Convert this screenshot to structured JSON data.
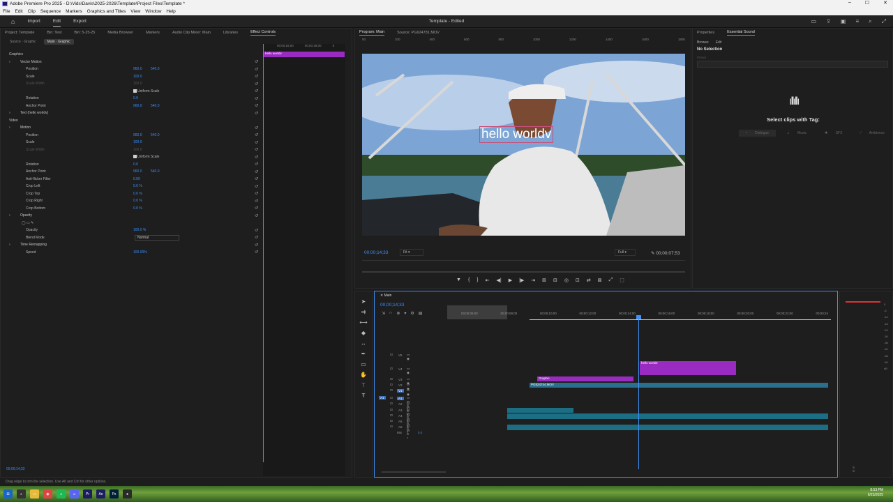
{
  "titlebar": {
    "title": "Adobe Premiere Pro 2025 - D:\\Vids\\Davis\\2025-2026\\Template\\Project Files\\Template *",
    "min": "–",
    "max": "☐",
    "close": "✕"
  },
  "menu": [
    "File",
    "Edit",
    "Clip",
    "Sequence",
    "Markers",
    "Graphics and Titles",
    "View",
    "Window",
    "Help"
  ],
  "appbar": {
    "workspaces": [
      "Import",
      "Edit",
      "Export"
    ],
    "project": "Template - Edited"
  },
  "left_tabs": [
    "Project: Template",
    "Bin: Test",
    "Bin: 5-25-25",
    "Media Browser",
    "Markers",
    "Audio Clip Mixer: Main",
    "Libraries",
    "Effect Controls"
  ],
  "ec": {
    "source_master": "Source · Graphic",
    "source_clip": "Main · Graphic",
    "rows": [
      {
        "label": "Graphics",
        "indent": 12,
        "kind": "header"
      },
      {
        "label": "Vector Motion",
        "indent": 28,
        "kind": "sect"
      },
      {
        "label": "Position",
        "indent": 36,
        "v1": "960.0",
        "v2": "540.0"
      },
      {
        "label": "Scale",
        "indent": 36,
        "v1": "100.0"
      },
      {
        "label": "Scale Width",
        "indent": 36,
        "v1": "100.0",
        "kind": "dim"
      },
      {
        "label": "Uniform Scale",
        "indent": 196,
        "kind": "chk"
      },
      {
        "label": "Rotation",
        "indent": 36,
        "v1": "0.0"
      },
      {
        "label": "Anchor Point",
        "indent": 36,
        "v1": "960.0",
        "v2": "540.0"
      },
      {
        "label": "Text (hello worldv)",
        "indent": 28,
        "kind": "sect"
      },
      {
        "label": "Video",
        "indent": 12,
        "kind": "header"
      },
      {
        "label": "Motion",
        "indent": 28,
        "kind": "sect"
      },
      {
        "label": "Position",
        "indent": 36,
        "v1": "960.0",
        "v2": "540.0"
      },
      {
        "label": "Scale",
        "indent": 36,
        "v1": "100.0"
      },
      {
        "label": "Scale Width",
        "indent": 36,
        "v1": "100.0",
        "kind": "dim"
      },
      {
        "label": "Uniform Scale",
        "indent": 196,
        "kind": "chk"
      },
      {
        "label": "Rotation",
        "indent": 36,
        "v1": "0.0"
      },
      {
        "label": "Anchor Point",
        "indent": 36,
        "v1": "960.0",
        "v2": "540.0"
      },
      {
        "label": "Anti-flicker Filter",
        "indent": 36,
        "v1": "0.00"
      },
      {
        "label": "Crop Left",
        "indent": 36,
        "v1": "0.0 %"
      },
      {
        "label": "Crop Top",
        "indent": 36,
        "v1": "0.0 %"
      },
      {
        "label": "Crop Right",
        "indent": 36,
        "v1": "0.0 %"
      },
      {
        "label": "Crop Bottom",
        "indent": 36,
        "v1": "0.0 %"
      },
      {
        "label": "Opacity",
        "indent": 28,
        "kind": "sect"
      },
      {
        "label": "",
        "indent": 36,
        "kind": "masks"
      },
      {
        "label": "Opacity",
        "indent": 36,
        "v1": "100.0 %"
      },
      {
        "label": "Blend Mode",
        "indent": 36,
        "kind": "blend",
        "v1": "Normal"
      },
      {
        "label": "Time Remapping",
        "indent": 28,
        "kind": "sect"
      },
      {
        "label": "Speed",
        "indent": 36,
        "v1": "100.00%"
      }
    ],
    "mini_ruler": [
      "00;00;16;00",
      "00;00;18;00",
      "0"
    ],
    "mini_clip": "hello worldv",
    "timecode": "00;00;14;33"
  },
  "program": {
    "tabs": [
      "Program: Main",
      "Source: PG924781.MOV"
    ],
    "ruler": [
      "00",
      "200",
      "400",
      "600",
      "800",
      "1000",
      "1200",
      "1400",
      "1600",
      "1800"
    ],
    "overlay_text": "hello worldv",
    "timecode": "00;00;14;33",
    "fit": "Fit",
    "quality": "Full",
    "duration": "00;00;07;53",
    "controls": [
      "▼",
      "{",
      "}",
      "⇤",
      "◀|",
      "▶",
      "|▶",
      "⇥",
      "⊞",
      "⊟",
      "◎",
      "⊡",
      "⇄",
      "⊠",
      "⤢",
      "⬚"
    ]
  },
  "es": {
    "tabs": [
      "Properties",
      "Essential Sound"
    ],
    "sub": [
      "Browse",
      "Edit"
    ],
    "no_selection": "No Selection",
    "preset": "Preset",
    "tag_title": "Select clips with Tag:",
    "tags": [
      "Dialogue",
      "Music",
      "SFX",
      "Ambience"
    ]
  },
  "timeline": {
    "tab": "Main",
    "timecode": "00;00;14;33",
    "ruler": [
      "00;00;06;00",
      "00;00;08;00",
      "00;00;10;00",
      "00;00;12;00",
      "00;00;14;00",
      "00;00;16;00",
      "00;00;18;00",
      "00;00;20;00",
      "00;00;22;00",
      "00;00;24"
    ],
    "tracks": [
      {
        "name": "V5",
        "kind": "v"
      },
      {
        "name": "V4",
        "kind": "v"
      },
      {
        "name": "V3",
        "kind": "v"
      },
      {
        "name": "V2",
        "kind": "v"
      },
      {
        "name": "V1",
        "kind": "v",
        "target": true
      },
      {
        "name": "A1",
        "kind": "a",
        "target": true
      },
      {
        "name": "A2",
        "kind": "a"
      },
      {
        "name": "A3",
        "kind": "a"
      },
      {
        "name": "A4",
        "kind": "a"
      },
      {
        "name": "A5",
        "kind": "a"
      },
      {
        "name": "A6",
        "kind": "a"
      }
    ],
    "src_patch": "A1",
    "mix_label": "Mix",
    "mix_value": "0.0",
    "clips": {
      "graphic": "Graphic",
      "mov": "PG924744.MOV",
      "text": "hello worldv",
      "fx": "fx"
    }
  },
  "meter": {
    "scale": [
      "0",
      "-6",
      "-12",
      "-18",
      "-24",
      "-30",
      "-36",
      "-42",
      "-48",
      "-54",
      "dB"
    ],
    "bottom": [
      "S",
      "S"
    ]
  },
  "status": "Drag edge to trim the selection. Use Alt and Ctrl for other options.",
  "clock": {
    "time": "8:53 PM",
    "date": "6/23/2025"
  }
}
